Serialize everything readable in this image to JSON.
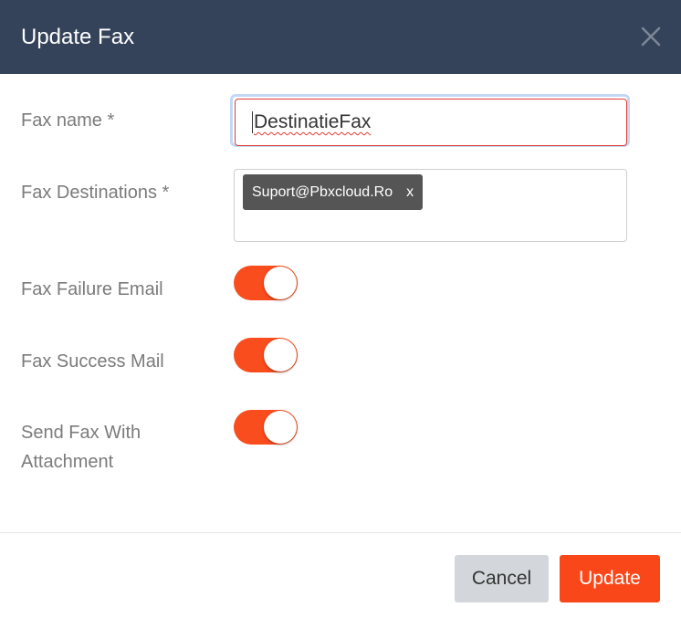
{
  "dialog": {
    "title": "Update Fax",
    "close_icon": "close-icon"
  },
  "form": {
    "fax_name": {
      "label": "Fax name *",
      "value": "DestinatieFax"
    },
    "fax_destinations": {
      "label": "Fax Destinations *",
      "tags": [
        {
          "text": "Suport@Pbxcloud.Ro",
          "remove": "x"
        }
      ]
    },
    "fax_failure_email": {
      "label": "Fax Failure Email",
      "enabled": true
    },
    "fax_success_mail": {
      "label": "Fax Success Mail",
      "enabled": true
    },
    "send_fax_with_attachment": {
      "label_line1": "Send Fax With",
      "label_line2": "Attachment",
      "enabled": true
    }
  },
  "footer": {
    "cancel_label": "Cancel",
    "update_label": "Update"
  },
  "colors": {
    "header_bg": "#35435a",
    "accent": "#fa4d1e",
    "chip_bg": "#555555",
    "error_border": "#e23b30"
  }
}
